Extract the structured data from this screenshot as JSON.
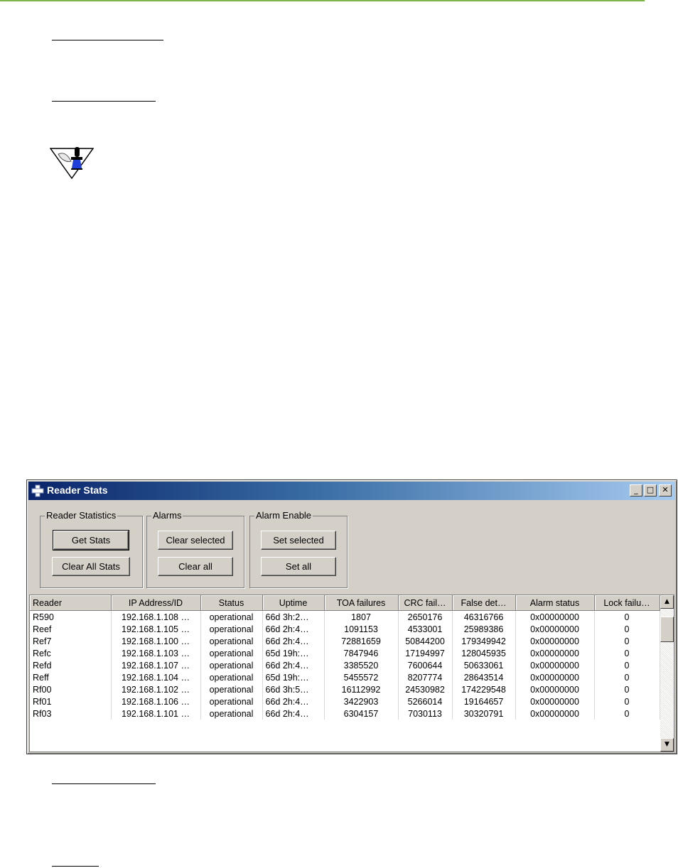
{
  "window": {
    "title": "Reader Stats",
    "controls": {
      "minimize": "_",
      "maximize": "□",
      "close": "✕"
    }
  },
  "groups": {
    "reader_statistics": {
      "label": "Reader Statistics",
      "get_stats": "Get Stats",
      "clear_all_stats": "Clear All Stats"
    },
    "alarms": {
      "label": "Alarms",
      "clear_selected": "Clear selected",
      "clear_all": "Clear all"
    },
    "alarm_enable": {
      "label": "Alarm Enable",
      "set_selected": "Set selected",
      "set_all": "Set all"
    }
  },
  "table": {
    "columns": [
      "Reader",
      "IP Address/ID",
      "Status",
      "Uptime",
      "TOA failures",
      "CRC fail…",
      "False det…",
      "Alarm status",
      "Lock failu…"
    ],
    "rows": [
      [
        "R590",
        "192.168.1.108 …",
        "operational",
        "66d 3h:2…",
        "1807",
        "2650176",
        "46316766",
        "0x00000000",
        "0"
      ],
      [
        "Reef",
        "192.168.1.105 …",
        "operational",
        "66d 2h:4…",
        "1091153",
        "4533001",
        "25989386",
        "0x00000000",
        "0"
      ],
      [
        "Ref7",
        "192.168.1.100 …",
        "operational",
        "66d 2h:4…",
        "72881659",
        "50844200",
        "179349942",
        "0x00000000",
        "0"
      ],
      [
        "Refc",
        "192.168.1.103 …",
        "operational",
        "65d 19h:…",
        "7847946",
        "17194997",
        "128045935",
        "0x00000000",
        "0"
      ],
      [
        "Refd",
        "192.168.1.107 …",
        "operational",
        "66d 2h:4…",
        "3385520",
        "7600644",
        "50633061",
        "0x00000000",
        "0"
      ],
      [
        "Reff",
        "192.168.1.104 …",
        "operational",
        "65d 19h:…",
        "5455572",
        "8207774",
        "28643514",
        "0x00000000",
        "0"
      ],
      [
        "Rf00",
        "192.168.1.102 …",
        "operational",
        "66d 3h:5…",
        "16112992",
        "24530982",
        "174229548",
        "0x00000000",
        "0"
      ],
      [
        "Rf01",
        "192.168.1.106 …",
        "operational",
        "66d 2h:4…",
        "3422903",
        "5266014",
        "19164657",
        "0x00000000",
        "0"
      ],
      [
        "Rf03",
        "192.168.1.101 …",
        "operational",
        "66d 2h:4…",
        "6304157",
        "7030113",
        "30320791",
        "0x00000000",
        "0"
      ]
    ]
  },
  "scrollbar": {
    "up": "▲",
    "down": "▼"
  },
  "colors": {
    "accent_rule": "#7fb24a",
    "title_start": "#0a246a",
    "title_end": "#a6caf0",
    "face": "#d4d0c8"
  },
  "icons": [
    "note-icon",
    "window-app-icon"
  ]
}
